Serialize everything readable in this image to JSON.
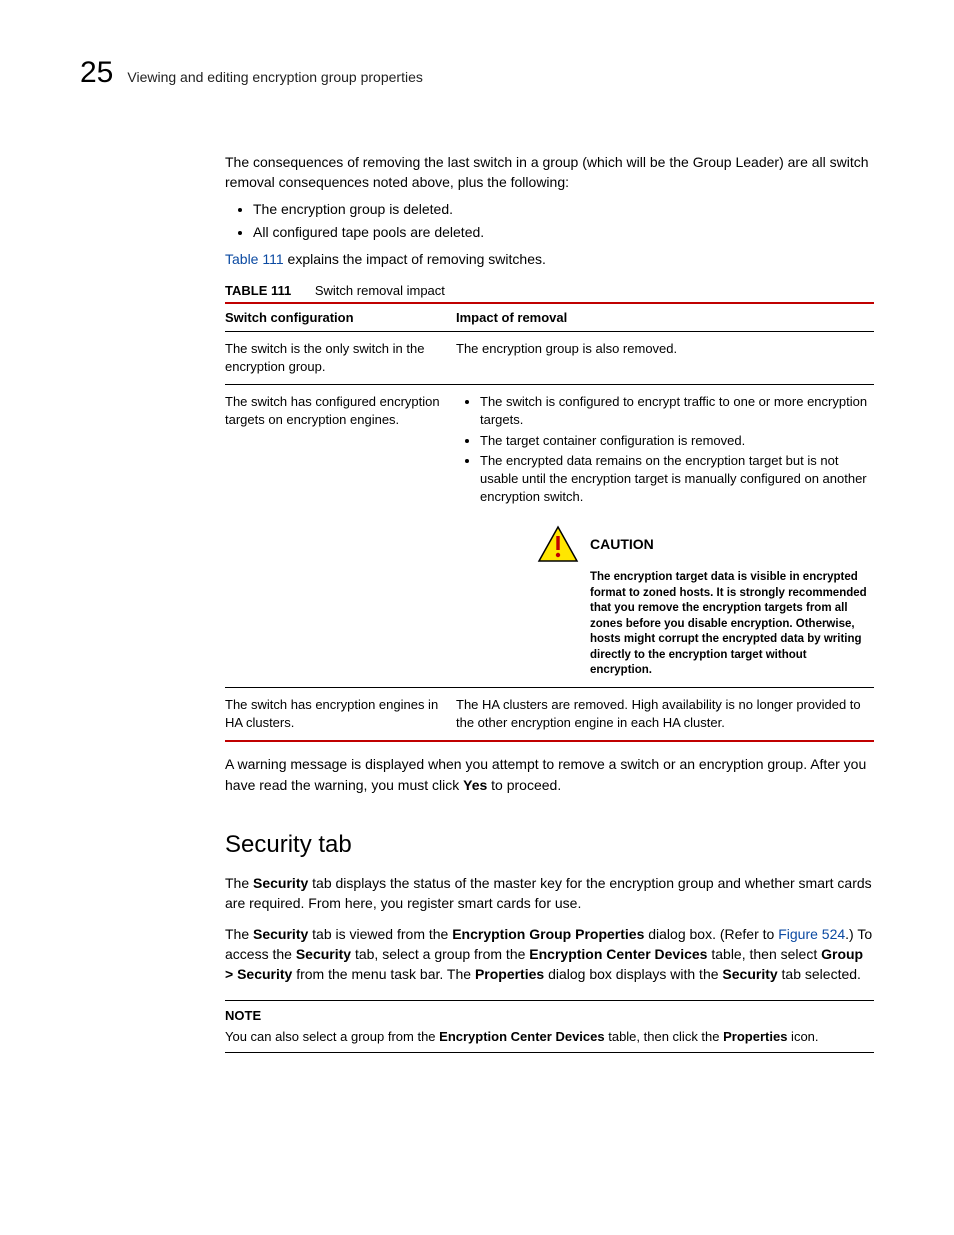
{
  "header": {
    "chapter_number": "25",
    "chapter_title": "Viewing and editing encryption group properties"
  },
  "intro": {
    "para": "The consequences of removing the last switch in a group (which will be the Group Leader) are all switch removal consequences noted above, plus the following:",
    "bullets": [
      "The encryption group is deleted.",
      "All configured tape pools are deleted."
    ],
    "table_ref_link": "Table 111",
    "table_ref_rest": " explains the impact of removing switches."
  },
  "table": {
    "caption_label": "TABLE 111",
    "caption_title": "Switch removal impact",
    "columns": [
      "Switch configuration",
      "Impact of removal"
    ],
    "rows": {
      "r1": {
        "config": "The switch is the only switch in the encryption group.",
        "impact_text": "The encryption group is also removed."
      },
      "r2": {
        "config": "The switch has configured encryption targets on encryption engines.",
        "impact_bullets": [
          "The switch is configured to encrypt traffic to one or more encryption targets.",
          "The target container configuration is removed.",
          "The encrypted data remains on the encryption target but is not usable until the encryption target is manually configured on another encryption switch."
        ],
        "caution_title": "CAUTION",
        "caution_text": "The encryption target data is visible in encrypted format to zoned hosts. It is strongly recommended that you remove the encryption targets from all zones before you disable encryption. Otherwise, hosts might corrupt the encrypted data by writing directly to the encryption target without encryption."
      },
      "r3": {
        "config": "The switch has encryption engines in HA clusters.",
        "impact_text": "The HA clusters are removed. High availability is no longer provided to the other encryption engine in each HA cluster."
      }
    }
  },
  "after_table": {
    "pre": "A warning message is displayed when you attempt to remove a switch or an encryption group. After you have read the warning, you must click ",
    "bold": "Yes",
    "post": " to proceed."
  },
  "security": {
    "heading": "Security tab",
    "p1": {
      "pre": "The ",
      "b1": "Security",
      "post": " tab displays the status of the master key for the encryption group and whether smart cards are required. From here, you register smart cards for use."
    },
    "p2": {
      "s1_pre": "The ",
      "s1_b": "Security",
      "s1_mid": " tab is viewed from the ",
      "s1_b2": "Encryption Group Properties",
      "s1_post": " dialog box. (Refer to ",
      "s1_link": "Figure 524",
      "s1_end": ".) To access the ",
      "s2_b": "Security",
      "s2_mid": " tab, select a group from the ",
      "s2_b2": "Encryption Center Devices",
      "s2_post": " table, then select ",
      "s3_b": "Group > Security",
      "s3_mid": " from the menu task bar. The ",
      "s3_b2": "Properties",
      "s3_mid2": " dialog box displays with the ",
      "s3_b3": "Security",
      "s3_end": " tab selected."
    },
    "note": {
      "label": "NOTE",
      "pre": "You can also select a group from the ",
      "b1": "Encryption Center Devices",
      "mid": " table, then click the ",
      "b2": "Properties",
      "post": " icon."
    }
  }
}
